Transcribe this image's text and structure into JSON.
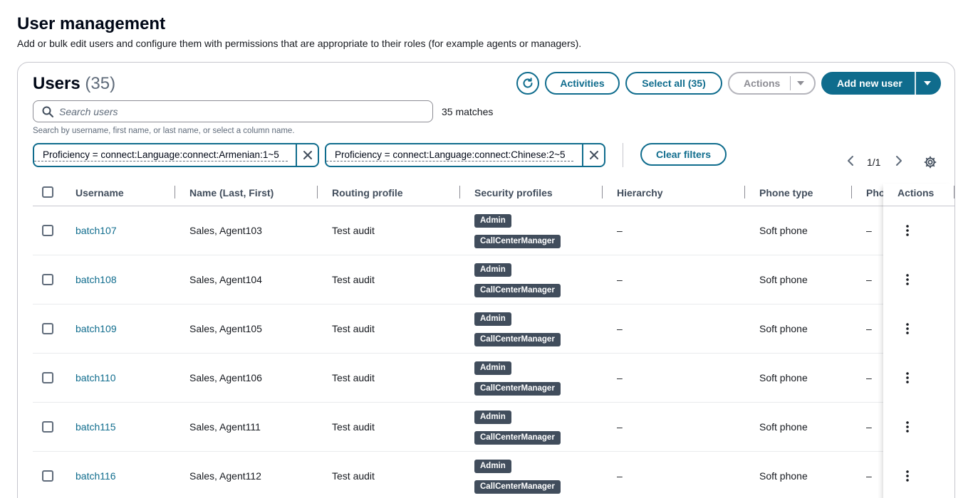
{
  "page": {
    "title": "User management",
    "description": "Add or bulk edit users and configure them with permissions that are appropriate to their roles (for example agents or managers)."
  },
  "users_panel": {
    "title": "Users",
    "count": "(35)",
    "buttons": {
      "activities": "Activities",
      "select_all": "Select all (35)",
      "actions": "Actions",
      "add_new_user": "Add new user",
      "clear_filters": "Clear filters"
    },
    "search": {
      "placeholder": "Search users",
      "value": "",
      "matches": "35 matches",
      "hint": "Search by username, first name, or last name, or select a column name."
    },
    "filters": [
      "Proficiency = connect:Language:connect:Armenian:1~5",
      "Proficiency = connect:Language:connect:Chinese:2~5"
    ],
    "pagination": {
      "text": "1/1"
    }
  },
  "table": {
    "columns": [
      "Username",
      "Name (Last, First)",
      "Routing profile",
      "Security profiles",
      "Hierarchy",
      "Phone type",
      "Pho",
      "Actions"
    ],
    "rows": [
      {
        "username": "batch107",
        "name": "Sales, Agent103",
        "routing": "Test audit",
        "profiles": [
          "Admin",
          "CallCenterManager"
        ],
        "hierarchy": "–",
        "phone_type": "Soft phone",
        "phone": "–"
      },
      {
        "username": "batch108",
        "name": "Sales, Agent104",
        "routing": "Test audit",
        "profiles": [
          "Admin",
          "CallCenterManager"
        ],
        "hierarchy": "–",
        "phone_type": "Soft phone",
        "phone": "–"
      },
      {
        "username": "batch109",
        "name": "Sales, Agent105",
        "routing": "Test audit",
        "profiles": [
          "Admin",
          "CallCenterManager"
        ],
        "hierarchy": "–",
        "phone_type": "Soft phone",
        "phone": "–"
      },
      {
        "username": "batch110",
        "name": "Sales, Agent106",
        "routing": "Test audit",
        "profiles": [
          "Admin",
          "CallCenterManager"
        ],
        "hierarchy": "–",
        "phone_type": "Soft phone",
        "phone": "–"
      },
      {
        "username": "batch115",
        "name": "Sales, Agent111",
        "routing": "Test audit",
        "profiles": [
          "Admin",
          "CallCenterManager"
        ],
        "hierarchy": "–",
        "phone_type": "Soft phone",
        "phone": "–"
      },
      {
        "username": "batch116",
        "name": "Sales, Agent112",
        "routing": "Test audit",
        "profiles": [
          "Admin",
          "CallCenterManager"
        ],
        "hierarchy": "–",
        "phone_type": "Soft phone",
        "phone": "–"
      }
    ]
  },
  "colors": {
    "primary": "#0f6c8d",
    "badge": "#414d5c",
    "text": "#16191f",
    "muted": "#5f6b7a"
  },
  "icons": [
    "refresh-icon",
    "caret-down-icon",
    "search-icon",
    "close-icon",
    "chevron-left-icon",
    "chevron-right-icon",
    "gear-icon",
    "kebab-menu-icon"
  ]
}
